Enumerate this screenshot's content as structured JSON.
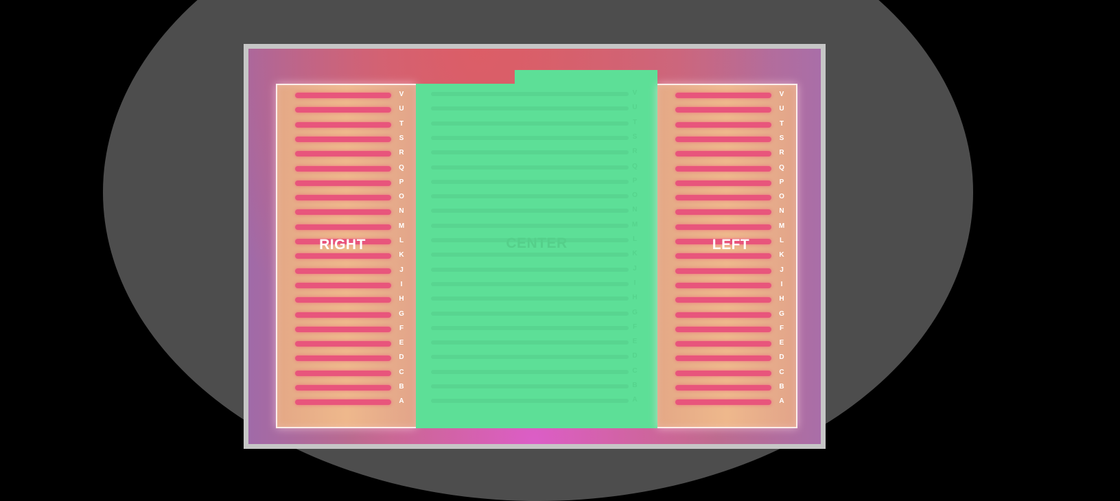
{
  "colors": {
    "background": "#000000",
    "venue": "#4d4d4d",
    "frame": "#c6c6c6",
    "side_section": "#eeb88c",
    "seat_row": "#e8557c",
    "center_section": "#5ddf97",
    "stage_glow": "#de5cd6"
  },
  "sections": {
    "right": {
      "name": "RIGHT",
      "rows": [
        "V",
        "U",
        "T",
        "S",
        "R",
        "Q",
        "P",
        "O",
        "N",
        "M",
        "L",
        "K",
        "J",
        "I",
        "H",
        "G",
        "F",
        "E",
        "D",
        "C",
        "B",
        "A"
      ]
    },
    "center": {
      "name": "CENTER",
      "rows": [
        "V",
        "U",
        "T",
        "S",
        "R",
        "Q",
        "P",
        "O",
        "N",
        "M",
        "L",
        "K",
        "J",
        "I",
        "H",
        "G",
        "F",
        "E",
        "D",
        "C",
        "B",
        "A"
      ]
    },
    "left": {
      "name": "LEFT",
      "rows": [
        "V",
        "U",
        "T",
        "S",
        "R",
        "Q",
        "P",
        "O",
        "N",
        "M",
        "L",
        "K",
        "J",
        "I",
        "H",
        "G",
        "F",
        "E",
        "D",
        "C",
        "B",
        "A"
      ]
    }
  }
}
